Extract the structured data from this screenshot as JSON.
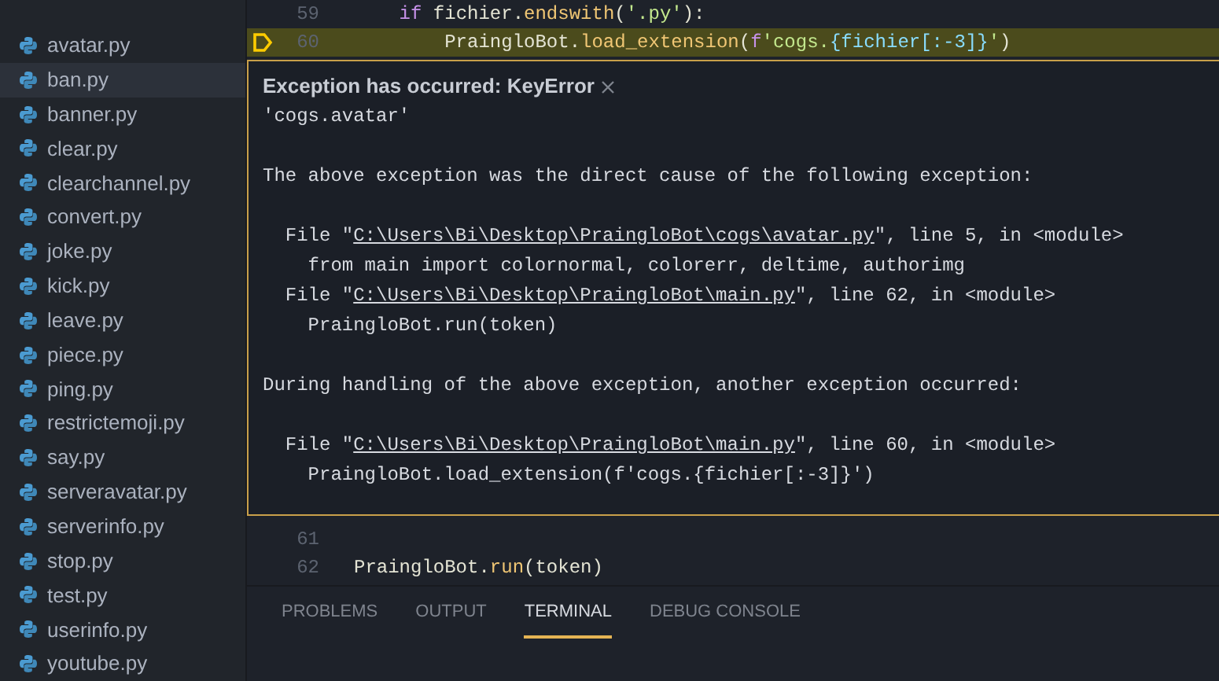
{
  "explorer": {
    "files": [
      {
        "name": "avatar.py",
        "selected": false
      },
      {
        "name": "ban.py",
        "selected": true
      },
      {
        "name": "banner.py",
        "selected": false
      },
      {
        "name": "clear.py",
        "selected": false
      },
      {
        "name": "clearchannel.py",
        "selected": false
      },
      {
        "name": "convert.py",
        "selected": false
      },
      {
        "name": "joke.py",
        "selected": false
      },
      {
        "name": "kick.py",
        "selected": false
      },
      {
        "name": "leave.py",
        "selected": false
      },
      {
        "name": "piece.py",
        "selected": false
      },
      {
        "name": "ping.py",
        "selected": false
      },
      {
        "name": "restrictemoji.py",
        "selected": false
      },
      {
        "name": "say.py",
        "selected": false
      },
      {
        "name": "serveravatar.py",
        "selected": false
      },
      {
        "name": "serverinfo.py",
        "selected": false
      },
      {
        "name": "stop.py",
        "selected": false
      },
      {
        "name": "test.py",
        "selected": false
      },
      {
        "name": "userinfo.py",
        "selected": false
      },
      {
        "name": "youtube.py",
        "selected": false
      }
    ]
  },
  "editor": {
    "lines_before": [
      {
        "number": "59",
        "breakpoint": false,
        "current": false,
        "tokens": [
          {
            "kind": "keyword",
            "text": "    if "
          },
          {
            "kind": "plain",
            "text": "fichier."
          },
          {
            "kind": "func",
            "text": "endswith"
          },
          {
            "kind": "plain",
            "text": "("
          },
          {
            "kind": "string",
            "text": "'.py'"
          },
          {
            "kind": "plain",
            "text": "):"
          }
        ]
      },
      {
        "number": "60",
        "breakpoint": true,
        "current": true,
        "tokens": [
          {
            "kind": "plain",
            "text": "        PraingloBot."
          },
          {
            "kind": "func",
            "text": "load_extension"
          },
          {
            "kind": "plain",
            "text": "("
          },
          {
            "kind": "keyword",
            "text": "f"
          },
          {
            "kind": "string",
            "text": "'cogs."
          },
          {
            "kind": "brace",
            "text": "{fichier[:-3]}"
          },
          {
            "kind": "string",
            "text": "'"
          },
          {
            "kind": "plain",
            "text": ")"
          }
        ]
      }
    ],
    "exception": {
      "title": "Exception has occurred: KeyError",
      "message": "'cogs.avatar'",
      "lines": [
        {
          "kind": "blank"
        },
        {
          "kind": "text",
          "text": "The above exception was the direct cause of the following exception:"
        },
        {
          "kind": "blank"
        },
        {
          "kind": "file",
          "prefix": "  File \"",
          "path": "C:\\Users\\Bi\\Desktop\\PraingloBot\\cogs\\avatar.py",
          "suffix": "\", line 5, in <module>"
        },
        {
          "kind": "text",
          "text": "    from main import colornormal, colorerr, deltime, authorimg"
        },
        {
          "kind": "file",
          "prefix": "  File \"",
          "path": "C:\\Users\\Bi\\Desktop\\PraingloBot\\main.py",
          "suffix": "\", line 62, in <module>"
        },
        {
          "kind": "text",
          "text": "    PraingloBot.run(token)"
        },
        {
          "kind": "blank"
        },
        {
          "kind": "text",
          "text": "During handling of the above exception, another exception occurred:"
        },
        {
          "kind": "blank"
        },
        {
          "kind": "file",
          "prefix": "  File \"",
          "path": "C:\\Users\\Bi\\Desktop\\PraingloBot\\main.py",
          "suffix": "\", line 60, in <module>"
        },
        {
          "kind": "text",
          "text": "    PraingloBot.load_extension(f'cogs.{fichier[:-3]}')"
        }
      ]
    },
    "lines_after": [
      {
        "number": "61",
        "breakpoint": false,
        "current": false
      },
      {
        "number": "62",
        "breakpoint": false,
        "current": false,
        "tokens": [
          {
            "kind": "plain",
            "text": "PraingloBot."
          },
          {
            "kind": "func",
            "text": "run"
          },
          {
            "kind": "plain",
            "text": "(token)"
          }
        ]
      }
    ]
  },
  "panel": {
    "tabs": [
      {
        "label": "PROBLEMS",
        "selected": false
      },
      {
        "label": "OUTPUT",
        "selected": false
      },
      {
        "label": "TERMINAL",
        "selected": true
      },
      {
        "label": "DEBUG CONSOLE",
        "selected": false
      }
    ]
  }
}
